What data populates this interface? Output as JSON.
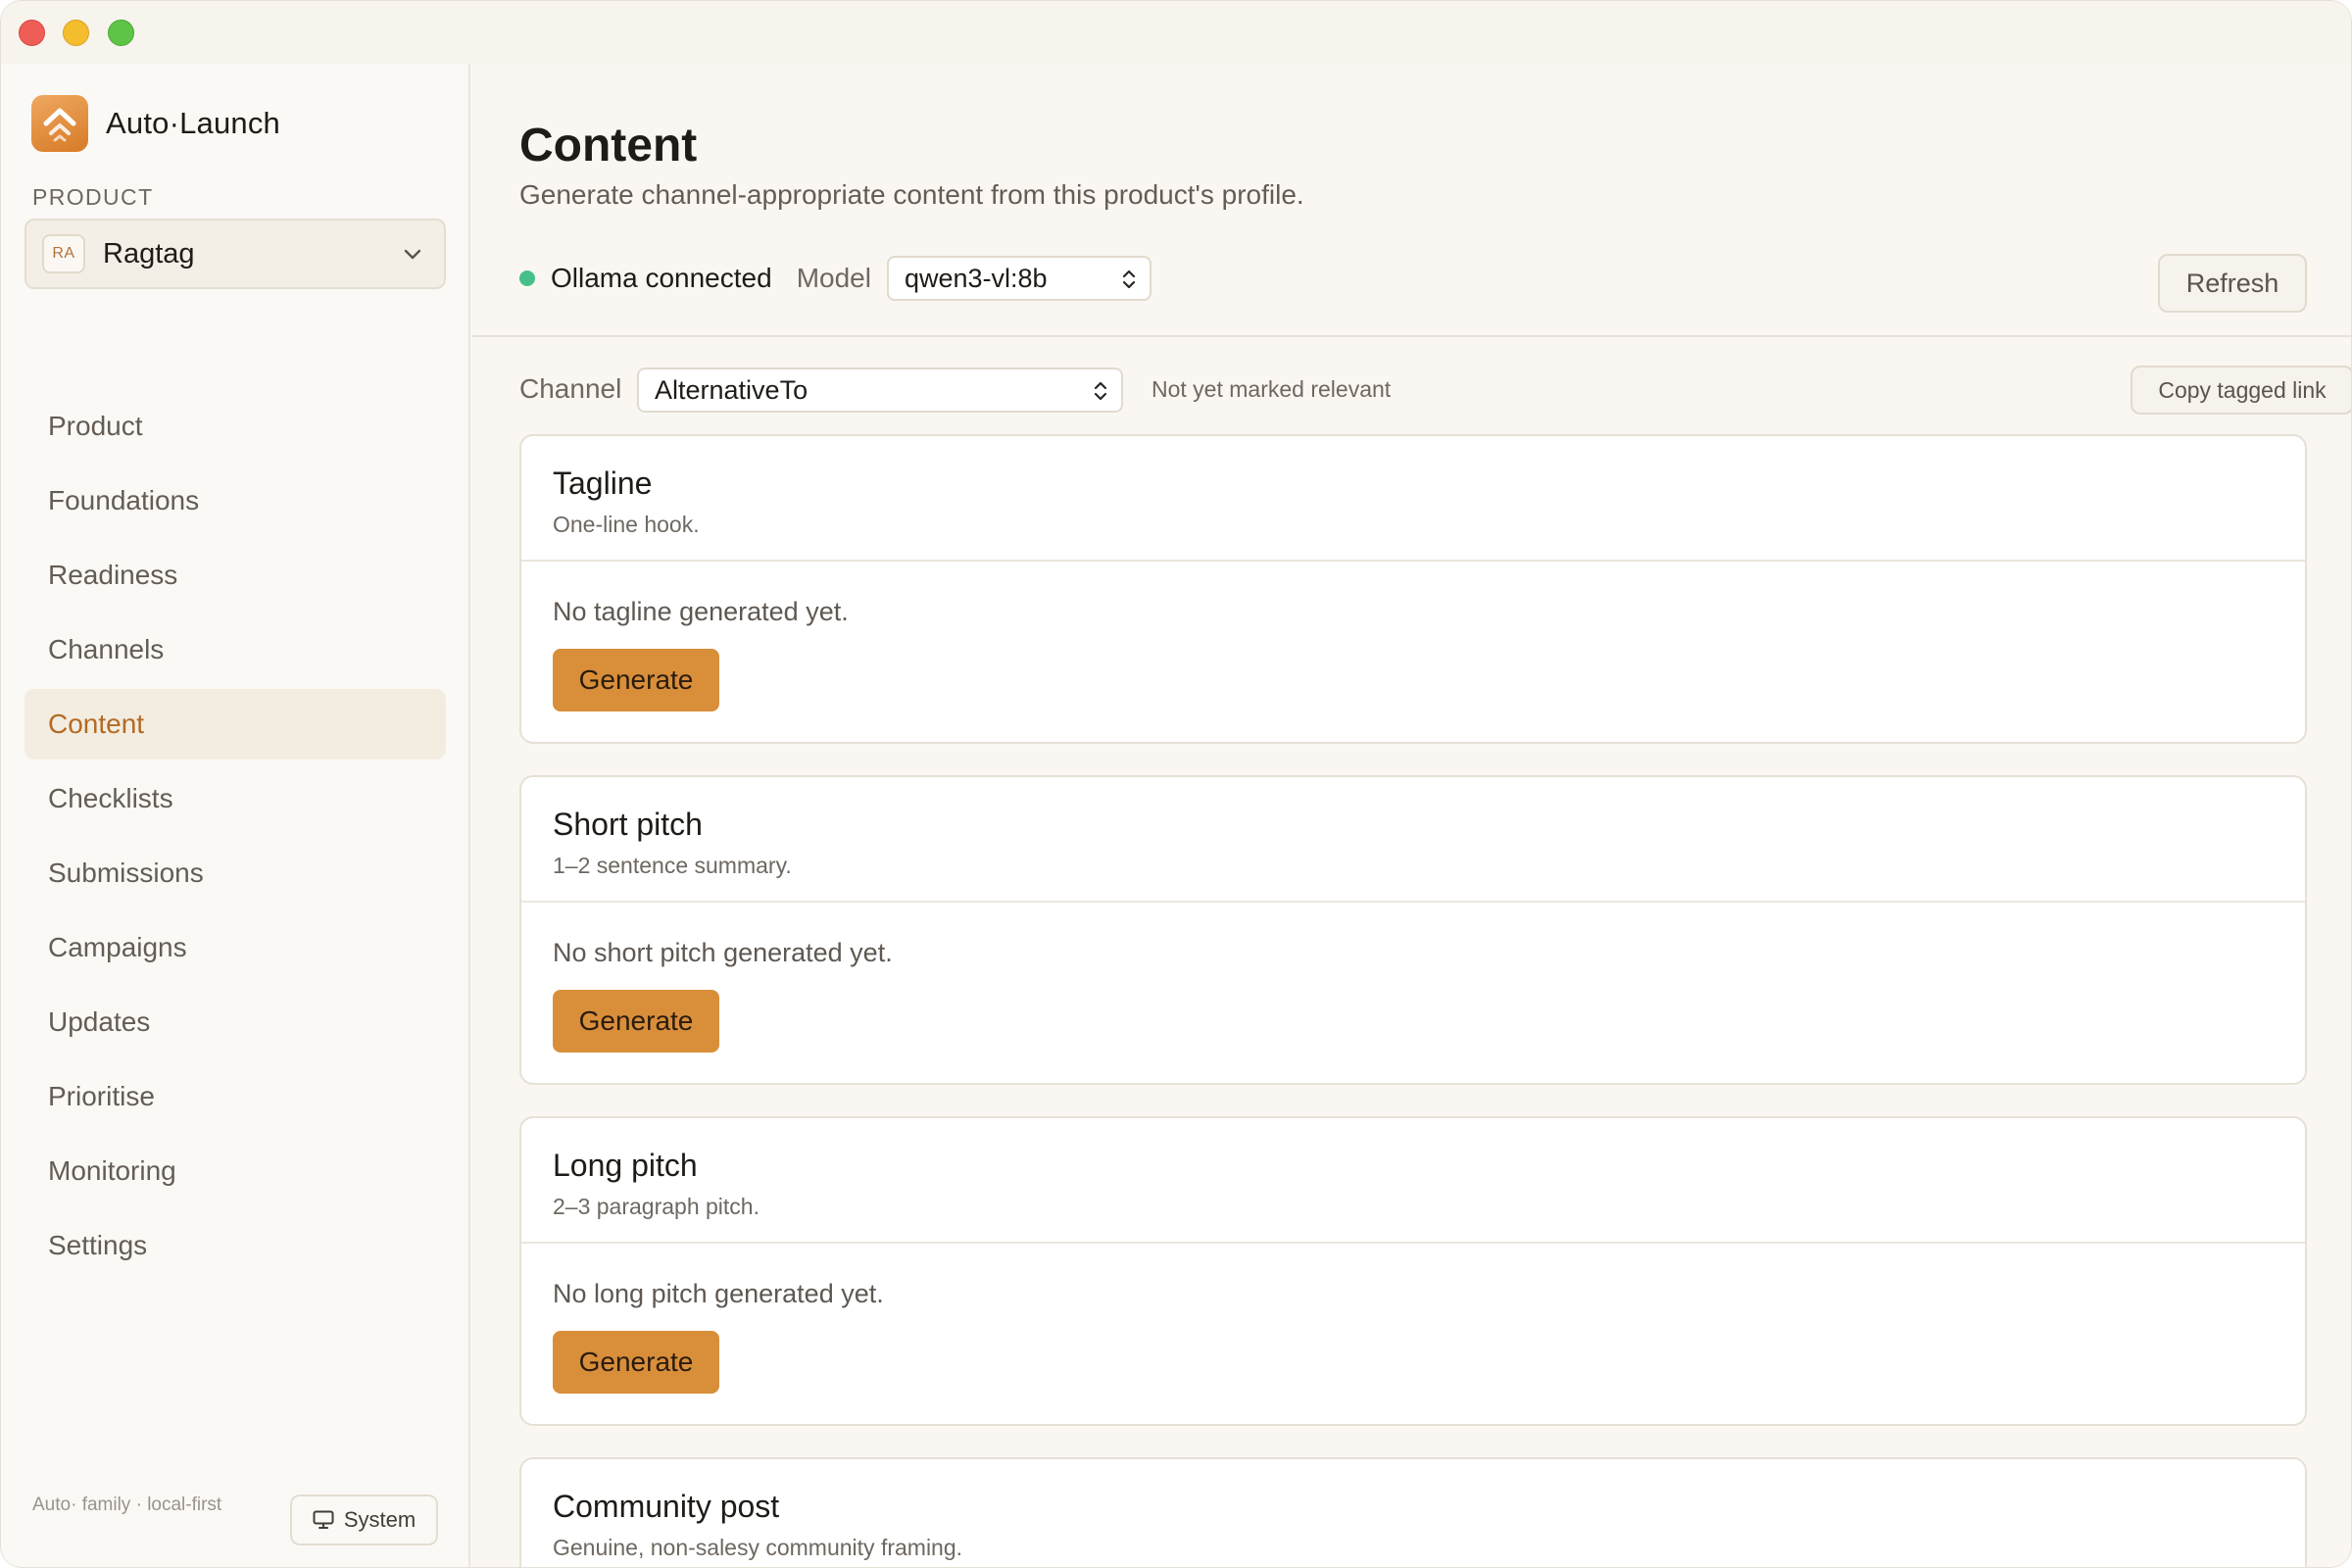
{
  "app": {
    "name": "Auto·Launch"
  },
  "sidebar": {
    "product_label": "PRODUCT",
    "product": {
      "initials": "RA",
      "name": "Ragtag"
    },
    "items": [
      {
        "label": "Product"
      },
      {
        "label": "Foundations"
      },
      {
        "label": "Readiness"
      },
      {
        "label": "Channels"
      },
      {
        "label": "Content",
        "active": true
      },
      {
        "label": "Checklists"
      },
      {
        "label": "Submissions"
      },
      {
        "label": "Campaigns"
      },
      {
        "label": "Updates"
      },
      {
        "label": "Prioritise"
      },
      {
        "label": "Monitoring"
      },
      {
        "label": "Settings"
      }
    ],
    "footer_text": "Auto· family · local-first",
    "theme_button": "System"
  },
  "main": {
    "title": "Content",
    "subtitle": "Generate channel-appropriate content from this product's profile.",
    "status": {
      "text": "Ollama connected",
      "color": "#45c08a"
    },
    "model_label": "Model",
    "model_value": "qwen3-vl:8b",
    "refresh_label": "Refresh",
    "channel_label": "Channel",
    "channel_value": "AlternativeTo",
    "channel_note": "Not yet marked relevant",
    "copy_link_label": "Copy tagged link",
    "cards": [
      {
        "title": "Tagline",
        "subtitle": "One-line hook.",
        "empty": "No tagline generated yet.",
        "button": "Generate"
      },
      {
        "title": "Short pitch",
        "subtitle": "1–2 sentence summary.",
        "empty": "No short pitch generated yet.",
        "button": "Generate"
      },
      {
        "title": "Long pitch",
        "subtitle": "2–3 paragraph pitch.",
        "empty": "No long pitch generated yet.",
        "button": "Generate"
      },
      {
        "title": "Community post",
        "subtitle": "Genuine, non-salesy community framing.",
        "empty": "",
        "button": ""
      }
    ]
  },
  "colors": {
    "accent": "#d98e3a",
    "active_nav_text": "#b36a24",
    "active_nav_bg": "#f3ece1"
  }
}
